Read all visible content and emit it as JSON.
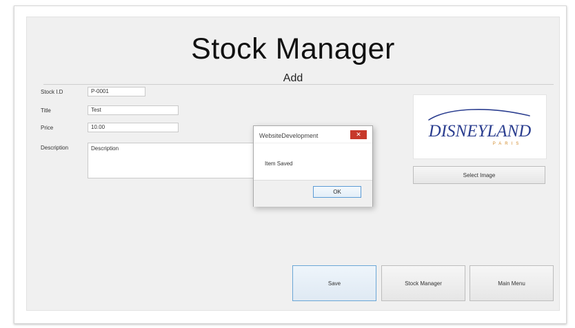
{
  "app": {
    "title": "Stock Manager",
    "subtitle": "Add"
  },
  "form": {
    "stock_id": {
      "label": "Stock I.D",
      "value": "P-0001"
    },
    "title": {
      "label": "Title",
      "value": "Test"
    },
    "price": {
      "label": "Price",
      "value": "10.00"
    },
    "description": {
      "label": "Description",
      "value": "Description"
    }
  },
  "image_panel": {
    "logo_text": "DISNEYLAND",
    "logo_subtext": "PARIS",
    "logo_color": "#2a3d8f",
    "select_image_label": "Select Image"
  },
  "buttons": {
    "save_label": "Save",
    "stock_manager_label": "Stock Manager",
    "main_menu_label": "Main Menu"
  },
  "dialog": {
    "title": "WebsiteDevelopment",
    "close_glyph": "✕",
    "close_color": "#c7392b",
    "message": "Item Saved",
    "ok_label": "OK"
  }
}
